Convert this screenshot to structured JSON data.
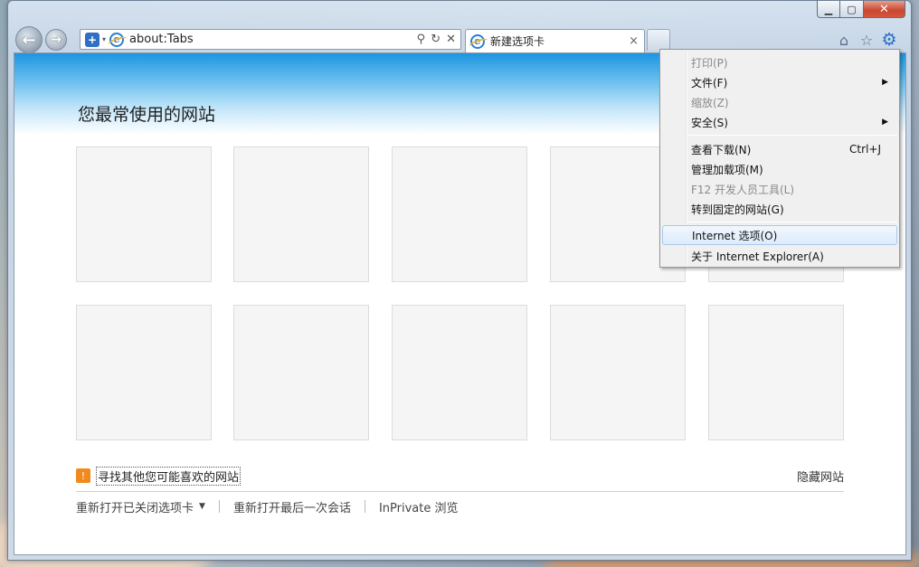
{
  "window": {
    "caption": {
      "minimize": "▁",
      "maximize": "▢",
      "close": "✕"
    }
  },
  "nav": {
    "back": "←",
    "forward": "→"
  },
  "address_bar": {
    "value": "about:Tabs",
    "shield_icon": "+",
    "dropdown_icon": "▾",
    "search_icon": "⚲",
    "refresh_icon": "↻",
    "stop_icon": "✕"
  },
  "tab": {
    "title": "新建选项卡",
    "close": "×"
  },
  "toolbar_icons": {
    "home": "⌂",
    "favorites": "☆",
    "tools": "⚙"
  },
  "page": {
    "heading": "您最常使用的网站",
    "find_sites_link": "寻找其他您可能喜欢的网站",
    "hide_sites_link": "隐藏网站",
    "reopen_closed_tabs": "重新打开已关闭选项卡",
    "reopen_caret": "▼",
    "reopen_last_session": "重新打开最后一次会话",
    "inprivate": "InPrivate 浏览",
    "bulb_icon": "💡"
  },
  "tools_menu": {
    "items": [
      {
        "label": "打印(P)",
        "disabled": true
      },
      {
        "label": "文件(F)",
        "submenu": "▶"
      },
      {
        "label": "缩放(Z)",
        "disabled": true
      },
      {
        "label": "安全(S)",
        "submenu": "▶"
      },
      {
        "label": "查看下载(N)",
        "accel": "Ctrl+J"
      },
      {
        "label": "管理加载项(M)"
      },
      {
        "label": "F12 开发人员工具(L)",
        "disabled": true
      },
      {
        "label": "转到固定的网站(G)"
      },
      {
        "label": "Internet 选项(O)",
        "highlighted": true
      },
      {
        "label": "关于 Internet Explorer(A)"
      }
    ]
  },
  "colors": {
    "banner_top": "#1d95e0",
    "tile_bg": "#f5f5f5",
    "accent_orange": "#f08a1e",
    "close_button": "#c9452e"
  }
}
